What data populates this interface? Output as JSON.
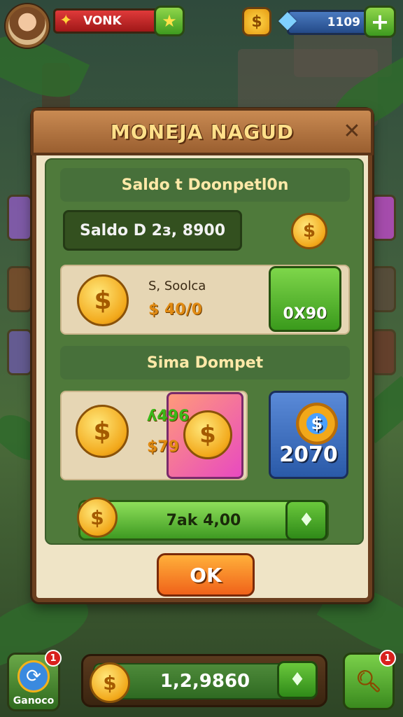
{
  "hud": {
    "player_name": "VONK",
    "gem_count": "1109",
    "coin_symbol": "$",
    "plus_label": "+"
  },
  "modal": {
    "title": "MONEJA NAGUD",
    "close_label": "✕",
    "section1_label": "Saldo t Doonpetl0n",
    "balance_text": "Saldo D 2з, 8900",
    "card1_small": "S, Soolca",
    "card1_big": "$ 40/0",
    "card1_button": "0X90",
    "section2_label": "Sima Dompet",
    "card2_line1": "ʎ496",
    "card2_line2": "$79",
    "blue_value": "2070",
    "total_text": "7ak 4,00",
    "ok_label": "OK"
  },
  "bottom": {
    "left_label": "Ganoco",
    "left_badge": "1",
    "center_value": "1,2,9860",
    "right_badge": "1"
  },
  "icons": {
    "coin": "coin-icon",
    "star": "star-icon",
    "gem": "gem-icon",
    "close": "close-icon",
    "diamond": "diamond-icon",
    "search": "search-icon",
    "refresh": "refresh-icon"
  },
  "colors": {
    "accent_green": "#3e9a1f",
    "accent_gold": "#f2a81a",
    "frame_brown": "#6b3f1f",
    "ok_orange": "#f0621a"
  }
}
